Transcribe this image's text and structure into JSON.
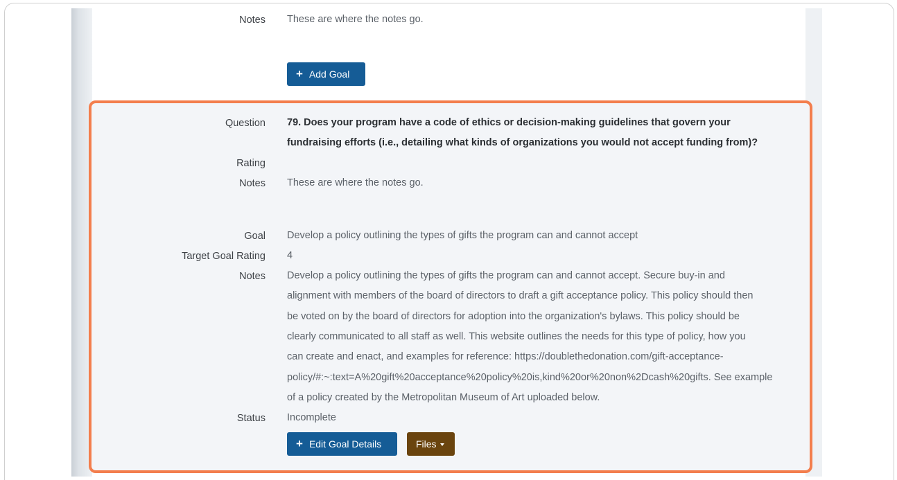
{
  "top_section": {
    "notes_label": "Notes",
    "notes_value": "These are where the notes go.",
    "add_goal_button": "Add Goal"
  },
  "question_card": {
    "question_label": "Question",
    "question_lines": [
      "79. Does your program have a code of ethics or decision-making guidelines that govern your",
      "fundraising efforts (i.e., detailing what kinds of organizations you would not accept funding from)?"
    ],
    "rating_label": "Rating",
    "rating_value": "",
    "notes_label": "Notes",
    "notes_value": "These are where the notes go.",
    "goal_label": "Goal",
    "goal_value": "Develop a policy outlining the types of gifts the program can and cannot accept",
    "target_rating_label": "Target Goal Rating",
    "target_rating_value": "4",
    "goal_notes_label": "Notes",
    "goal_notes_lines": [
      "Develop a policy outlining the types of gifts the program can and cannot accept. Secure buy-in and",
      "alignment with members of the board of directors to draft a gift acceptance policy. This policy should then",
      "be voted on by the board of directors for adoption into the organization's bylaws. This policy should be",
      "clearly communicated to all staff as well. This website outlines the needs for this type of policy, how you",
      "can create and enact, and examples for reference: https://doublethedonation.com/gift-acceptance-",
      "policy/#:~:text=A%20gift%20acceptance%20policy%20is,kind%20or%20non%2Dcash%20gifts. See example",
      "of a policy created by the Metropolitan Museum of Art uploaded below."
    ],
    "status_label": "Status",
    "status_value": "Incomplete",
    "edit_goal_button": "Edit Goal Details",
    "files_button": "Files",
    "highlight_color": "#f37e4d"
  },
  "colors": {
    "primary_button": "#155c96",
    "files_button": "#6a440e",
    "card_background": "#f3f5f8"
  },
  "icons": [
    "plus-icon",
    "caret-down-icon"
  ]
}
